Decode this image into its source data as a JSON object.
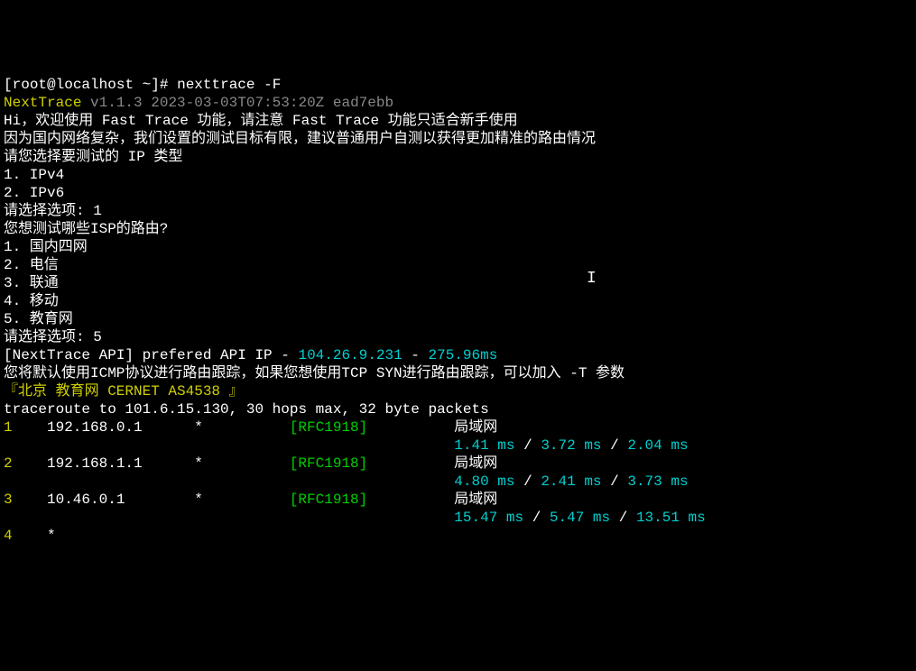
{
  "prompt": {
    "user": "root",
    "host": "localhost",
    "path": "~",
    "symbol": "#",
    "command": "nexttrace -F"
  },
  "header": {
    "app_name": "NextTrace",
    "version_line": " v1.1.3 2023-03-03T07:53:20Z ead7ebb"
  },
  "intro": {
    "line1_a": "Hi，欢迎使用 ",
    "line1_b": "Fast Trace",
    "line1_c": " 功能，请注意 ",
    "line1_d": "Fast Trace",
    "line1_e": " 功能只适合新手使用",
    "line2": "因为国内网络复杂，我们设置的测试目标有限，建议普通用户自测以获得更加精准的路由情况",
    "line3": "请您选择要测试的 IP 类型"
  },
  "ip_type": {
    "opt1": "1. IPv4",
    "opt2": "2. IPv6",
    "prompt_label": "请选择选项: ",
    "choice": "1"
  },
  "isp_prompt": "您想测试哪些ISP的路由?",
  "isp_options": {
    "o1": "1. 国内四网",
    "o2": "2. 电信",
    "o3": "3. 联通",
    "o4": "4. 移动",
    "o5": "5. 教育网"
  },
  "isp_choice_label": "请选择选项: ",
  "isp_choice": "5",
  "api": {
    "prefix": "[NextTrace API]",
    "label": " prefered API IP - ",
    "ip": "104.26.9.231",
    "sep": " - ",
    "latency": "275.96ms"
  },
  "protocol_hint": "您将默认使用ICMP协议进行路由跟踪，如果您想使用TCP SYN进行路由跟踪，可以加入 -T 参数",
  "target_banner": "『北京 教育网 CERNET AS4538 』",
  "traceroute_msg": "traceroute to 101.6.15.130, 30 hops max, 32 byte packets",
  "hops": {
    "h1": {
      "n": "1",
      "ip": "192.168.0.1",
      "star": "*",
      "rfc": "[RFC1918]",
      "loc": "局域网",
      "r1": "1.41 ms",
      "r2": "3.72 ms",
      "r3": "2.04 ms"
    },
    "h2": {
      "n": "2",
      "ip": "192.168.1.1",
      "star": "*",
      "rfc": "[RFC1918]",
      "loc": "局域网",
      "r1": "4.80 ms",
      "r2": "2.41 ms",
      "r3": "3.73 ms"
    },
    "h3": {
      "n": "3",
      "ip": "10.46.0.1",
      "star": "*",
      "rfc": "[RFC1918]",
      "loc": "局域网",
      "r1": "15.47 ms",
      "r2": "5.47 ms",
      "r3": "13.51 ms"
    },
    "h4": {
      "n": "4",
      "star": "*"
    }
  },
  "slash": " / "
}
